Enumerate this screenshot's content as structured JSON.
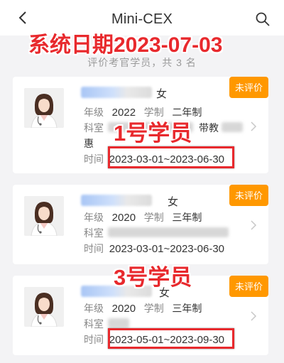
{
  "header": {
    "title": "Mini-CEX",
    "back_icon": "back-arrow-icon",
    "search_icon": "search-icon"
  },
  "overlay": {
    "system_date": "系统日期2023-07-03",
    "label_student1": "1号学员",
    "label_student3": "3号学员",
    "accent": "#e8292d"
  },
  "subtitle": "评价考官学员，共 3 名",
  "labels": {
    "grade": "年级",
    "system": "学制",
    "department": "科室",
    "time": "时间",
    "teacher": "带教"
  },
  "badge_color": "#ff9800",
  "students": [
    {
      "gender": "女",
      "grade": "2022",
      "system": "二年制",
      "extra": "惠",
      "time": "2023-03-01~2023-06-30",
      "badge": "未评价"
    },
    {
      "gender": "女",
      "grade": "2020",
      "system": "三年制",
      "time": "2023-03-01~2023-06-30",
      "badge": "未评价"
    },
    {
      "gender": "女",
      "grade": "2020",
      "system": "三年制",
      "time": "2023-05-01~2023-09-30",
      "badge": "未评价"
    }
  ]
}
